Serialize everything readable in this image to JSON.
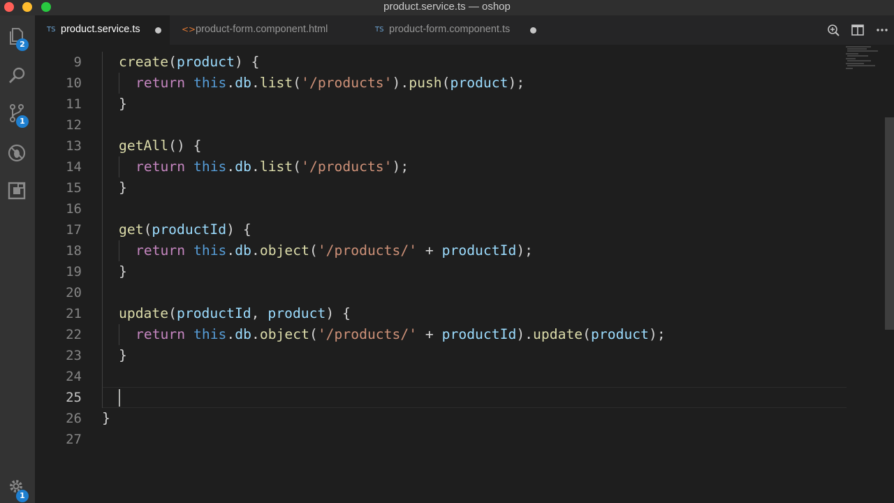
{
  "window": {
    "title": "product.service.ts — oshop"
  },
  "activity_bar": {
    "items": [
      {
        "name": "explorer-icon",
        "badge": "2"
      },
      {
        "name": "search-icon",
        "badge": ""
      },
      {
        "name": "source-control-icon",
        "badge": "1"
      },
      {
        "name": "debug-icon",
        "badge": ""
      },
      {
        "name": "extensions-icon",
        "badge": ""
      }
    ],
    "settings_badge": "1"
  },
  "tabs": [
    {
      "lang": "TS",
      "label": "product.service.ts",
      "active": true,
      "modified": true
    },
    {
      "lang": "<>",
      "label": "product-form.component.html",
      "active": false,
      "modified": false
    },
    {
      "lang": "TS",
      "label": "product-form.component.ts",
      "active": false,
      "modified": true
    }
  ],
  "editor": {
    "active_line": "25",
    "line_numbers": [
      "9",
      "10",
      "11",
      "12",
      "13",
      "14",
      "15",
      "16",
      "17",
      "18",
      "19",
      "20",
      "21",
      "22",
      "23",
      "24",
      "25",
      "26",
      "27"
    ],
    "lines": [
      {
        "indent": 1,
        "tokens": [
          {
            "t": "create",
            "c": "fn"
          },
          {
            "t": "(",
            "c": "p"
          },
          {
            "t": "product",
            "c": "var"
          },
          {
            "t": ") {",
            "c": "p"
          }
        ]
      },
      {
        "indent": 2,
        "tokens": [
          {
            "t": "return",
            "c": "kw"
          },
          {
            "t": " ",
            "c": "p"
          },
          {
            "t": "this",
            "c": "th"
          },
          {
            "t": ".",
            "c": "p"
          },
          {
            "t": "db",
            "c": "var"
          },
          {
            "t": ".",
            "c": "p"
          },
          {
            "t": "list",
            "c": "fn"
          },
          {
            "t": "(",
            "c": "p"
          },
          {
            "t": "'/products'",
            "c": "str"
          },
          {
            "t": ").",
            "c": "p"
          },
          {
            "t": "push",
            "c": "fn"
          },
          {
            "t": "(",
            "c": "p"
          },
          {
            "t": "product",
            "c": "var"
          },
          {
            "t": ");",
            "c": "p"
          }
        ]
      },
      {
        "indent": 1,
        "tokens": [
          {
            "t": "}",
            "c": "p"
          }
        ]
      },
      {
        "indent": 0,
        "tokens": []
      },
      {
        "indent": 1,
        "tokens": [
          {
            "t": "getAll",
            "c": "fn"
          },
          {
            "t": "() {",
            "c": "p"
          }
        ]
      },
      {
        "indent": 2,
        "tokens": [
          {
            "t": "return",
            "c": "kw"
          },
          {
            "t": " ",
            "c": "p"
          },
          {
            "t": "this",
            "c": "th"
          },
          {
            "t": ".",
            "c": "p"
          },
          {
            "t": "db",
            "c": "var"
          },
          {
            "t": ".",
            "c": "p"
          },
          {
            "t": "list",
            "c": "fn"
          },
          {
            "t": "(",
            "c": "p"
          },
          {
            "t": "'/products'",
            "c": "str"
          },
          {
            "t": ");",
            "c": "p"
          }
        ]
      },
      {
        "indent": 1,
        "tokens": [
          {
            "t": "}",
            "c": "p"
          }
        ]
      },
      {
        "indent": 0,
        "tokens": []
      },
      {
        "indent": 1,
        "tokens": [
          {
            "t": "get",
            "c": "fn"
          },
          {
            "t": "(",
            "c": "p"
          },
          {
            "t": "productId",
            "c": "var"
          },
          {
            "t": ") {",
            "c": "p"
          }
        ]
      },
      {
        "indent": 2,
        "tokens": [
          {
            "t": "return",
            "c": "kw"
          },
          {
            "t": " ",
            "c": "p"
          },
          {
            "t": "this",
            "c": "th"
          },
          {
            "t": ".",
            "c": "p"
          },
          {
            "t": "db",
            "c": "var"
          },
          {
            "t": ".",
            "c": "p"
          },
          {
            "t": "object",
            "c": "fn"
          },
          {
            "t": "(",
            "c": "p"
          },
          {
            "t": "'/products/'",
            "c": "str"
          },
          {
            "t": " + ",
            "c": "p"
          },
          {
            "t": "productId",
            "c": "var"
          },
          {
            "t": ");",
            "c": "p"
          }
        ]
      },
      {
        "indent": 1,
        "tokens": [
          {
            "t": "}",
            "c": "p"
          }
        ]
      },
      {
        "indent": 0,
        "tokens": []
      },
      {
        "indent": 1,
        "tokens": [
          {
            "t": "update",
            "c": "fn"
          },
          {
            "t": "(",
            "c": "p"
          },
          {
            "t": "productId",
            "c": "var"
          },
          {
            "t": ", ",
            "c": "p"
          },
          {
            "t": "product",
            "c": "var"
          },
          {
            "t": ") {",
            "c": "p"
          }
        ]
      },
      {
        "indent": 2,
        "tokens": [
          {
            "t": "return",
            "c": "kw"
          },
          {
            "t": " ",
            "c": "p"
          },
          {
            "t": "this",
            "c": "th"
          },
          {
            "t": ".",
            "c": "p"
          },
          {
            "t": "db",
            "c": "var"
          },
          {
            "t": ".",
            "c": "p"
          },
          {
            "t": "object",
            "c": "fn"
          },
          {
            "t": "(",
            "c": "p"
          },
          {
            "t": "'/products/'",
            "c": "str"
          },
          {
            "t": " + ",
            "c": "p"
          },
          {
            "t": "productId",
            "c": "var"
          },
          {
            "t": ").",
            "c": "p"
          },
          {
            "t": "update",
            "c": "fn"
          },
          {
            "t": "(",
            "c": "p"
          },
          {
            "t": "product",
            "c": "var"
          },
          {
            "t": ");",
            "c": "p"
          }
        ]
      },
      {
        "indent": 1,
        "tokens": [
          {
            "t": "}",
            "c": "p"
          }
        ]
      },
      {
        "indent": 0,
        "tokens": []
      },
      {
        "indent": 0,
        "tokens": []
      },
      {
        "indent": 0,
        "tokens": [
          {
            "t": "}",
            "c": "p"
          }
        ]
      },
      {
        "indent": 0,
        "tokens": []
      }
    ]
  },
  "colors": {
    "editor_bg": "#1e1e1e",
    "tabbar_bg": "#252526",
    "activitybar_bg": "#333333",
    "badge": "#1e7fd0",
    "keyword": "#c586c0",
    "this": "#569cd6",
    "function": "#dcdcaa",
    "variable": "#9cdcfe",
    "string": "#ce9178"
  }
}
